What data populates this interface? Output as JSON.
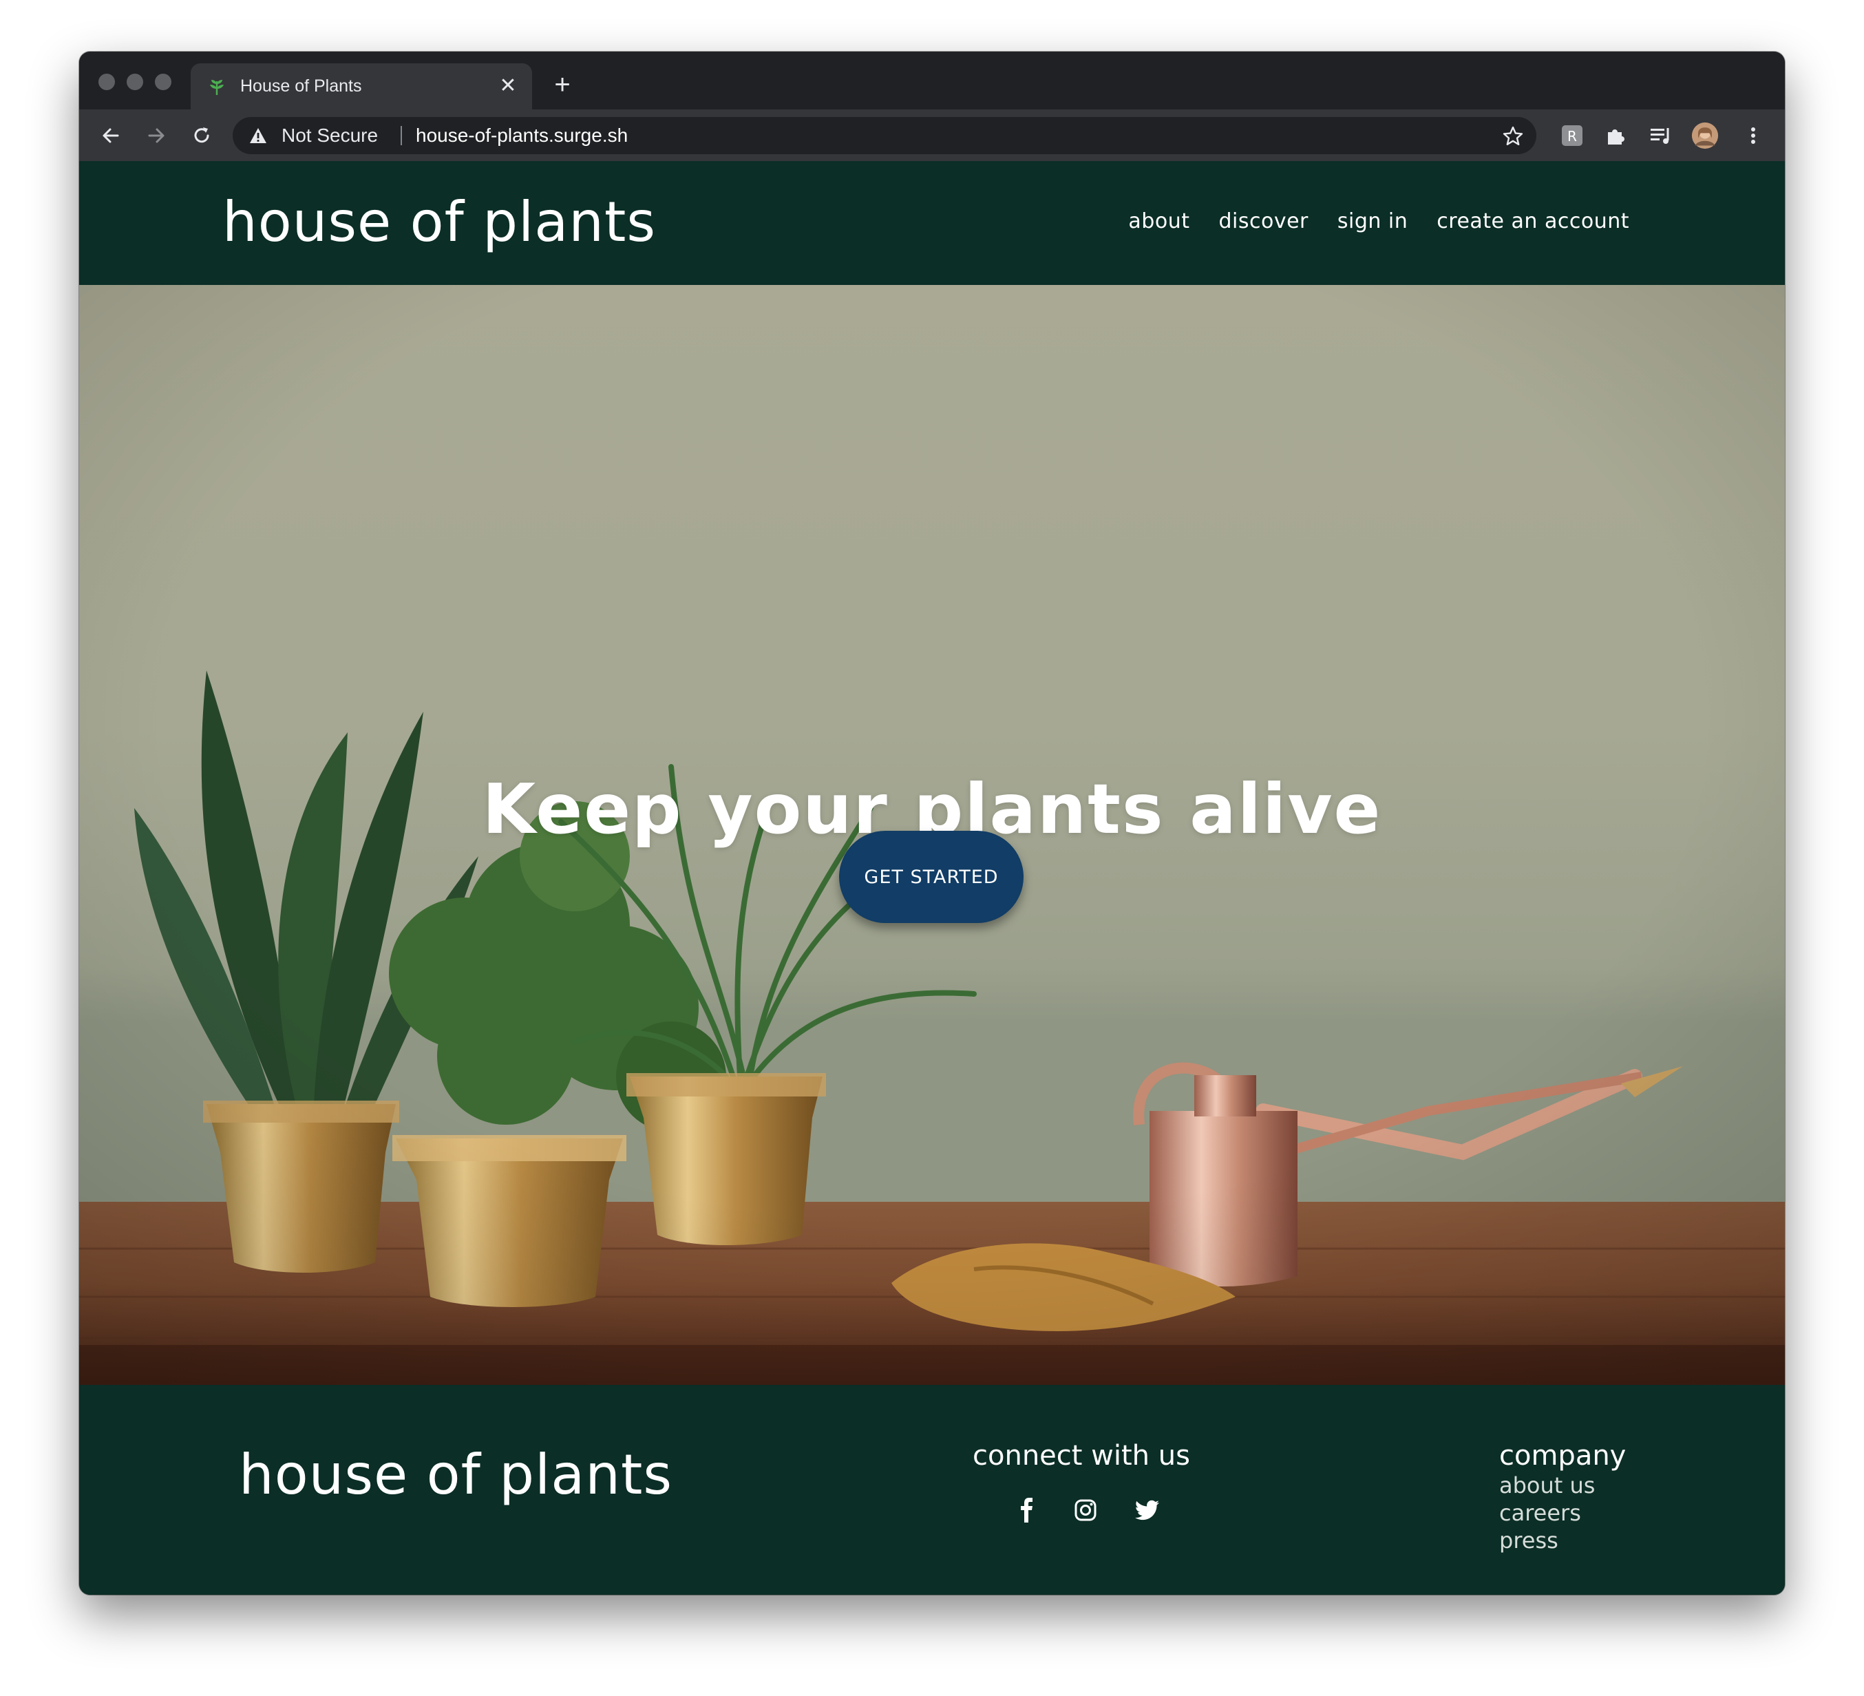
{
  "browser": {
    "tab_title": "House of Plants",
    "security_label": "Not Secure",
    "url": "house-of-plants.surge.sh"
  },
  "header": {
    "brand": "house of plants",
    "nav": [
      {
        "label": "about"
      },
      {
        "label": "discover"
      },
      {
        "label": "sign in"
      },
      {
        "label": "create an account"
      }
    ]
  },
  "hero": {
    "title": "Keep your plants alive",
    "cta_label": "GET STARTED"
  },
  "footer": {
    "brand": "house of plants",
    "connect_heading": "connect with us",
    "social_icons": [
      "facebook-icon",
      "instagram-icon",
      "twitter-icon"
    ],
    "company_heading": "company",
    "company_links": [
      {
        "label": "about us"
      },
      {
        "label": "careers"
      },
      {
        "label": "press"
      }
    ]
  },
  "colors": {
    "brand_dark_green": "#0b2e26",
    "cta_blue": "#113d66",
    "chrome_dark": "#202124",
    "chrome_mid": "#35363a"
  }
}
